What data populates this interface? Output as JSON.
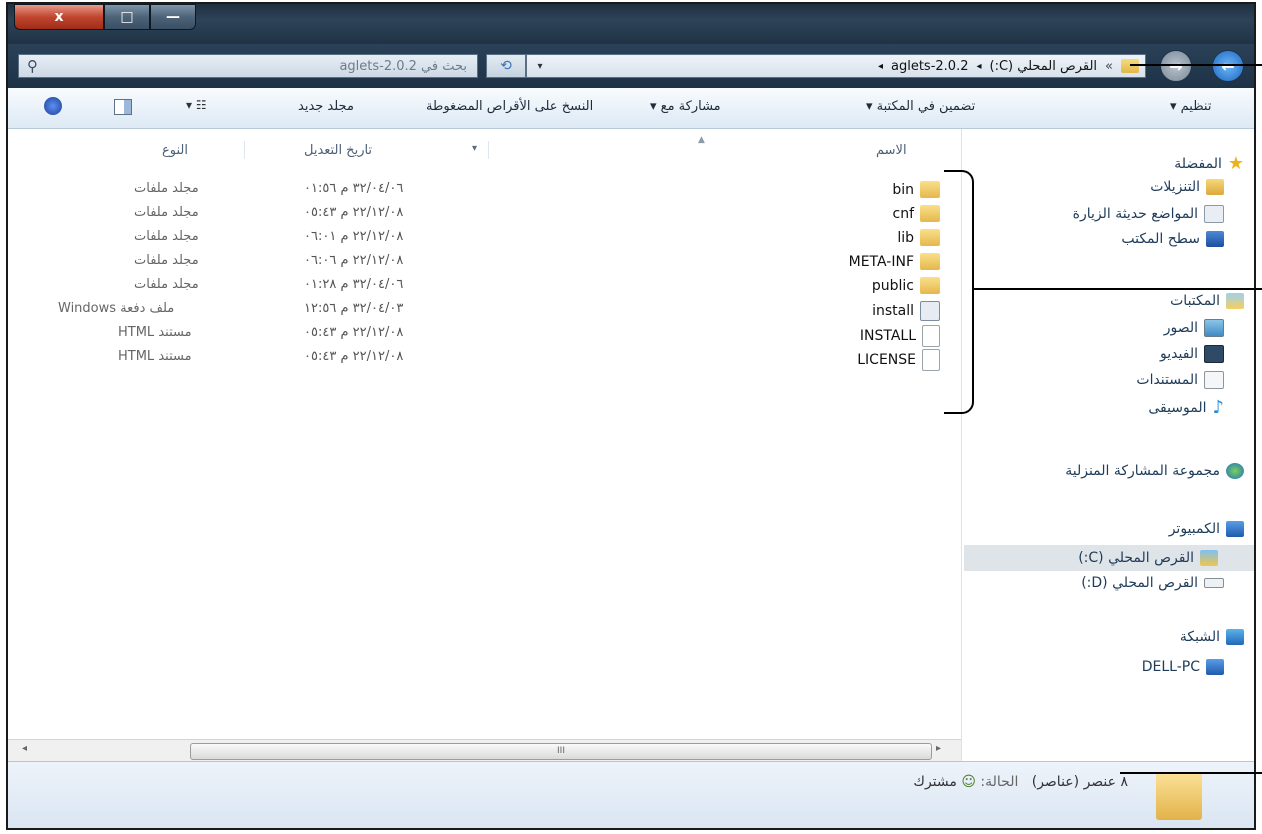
{
  "window": {
    "caption_close": "x",
    "caption_max": "□",
    "caption_min": "—"
  },
  "search": {
    "placeholder": "بحث في aglets-2.0.2",
    "icon": "search-icon"
  },
  "address": {
    "crumbs": [
      "القرص المحلي (C:)",
      "aglets-2.0.2"
    ],
    "prefix": "»",
    "sep": "◂",
    "dropdown": "▾",
    "refresh": "⟲"
  },
  "toolbar": {
    "organize": "تنظيم ▾",
    "include": "تضمين في المكتبة ▾",
    "share": "مشاركة مع ▾",
    "burn": "النسخ على الأقراص المضغوطة",
    "new_folder": "مجلد جديد"
  },
  "sidebar": {
    "favorites": "المفضلة",
    "downloads": "التنزيلات",
    "recent": "المواضع حديثة الزيارة",
    "desktop": "سطح المكتب",
    "libraries": "المكتبات",
    "pictures": "الصور",
    "videos": "الفيديو",
    "documents": "المستندات",
    "music": "الموسيقى",
    "homegroup": "مجموعة المشاركة المنزلية",
    "computer": "الكمبيوتر",
    "drive_c": "القرص المحلي (C:)",
    "drive_d": "القرص المحلي (D:)",
    "network": "الشبكة",
    "dell_pc": "DELL-PC"
  },
  "columns": {
    "name": "الاسم",
    "date": "تاريخ التعديل",
    "type": "النوع"
  },
  "files": [
    {
      "name": "bin",
      "kind": "folder",
      "date": "٣٢/٠٤/٠٦ م ٠١:٥٦",
      "type": "مجلد ملفات"
    },
    {
      "name": "cnf",
      "kind": "folder",
      "date": "٢٢/١٢/٠٨ م ٠٥:٤٣",
      "type": "مجلد ملفات"
    },
    {
      "name": "lib",
      "kind": "folder",
      "date": "٢٢/١٢/٠٨ م ٠٦:٠١",
      "type": "مجلد ملفات"
    },
    {
      "name": "META-INF",
      "kind": "folder",
      "date": "٢٢/١٢/٠٨ م ٠٦:٠٦",
      "type": "مجلد ملفات"
    },
    {
      "name": "public",
      "kind": "folder",
      "date": "٣٢/٠٤/٠٦ م ٠١:٢٨",
      "type": "مجلد ملفات"
    },
    {
      "name": "install",
      "kind": "batch",
      "date": "٣٢/٠٤/٠٣ م ١٢:٥٦",
      "type": "ملف دفعة Windows"
    },
    {
      "name": "INSTALL",
      "kind": "file",
      "date": "٢٢/١٢/٠٨ م ٠٥:٤٣",
      "type": "مستند HTML"
    },
    {
      "name": "LICENSE",
      "kind": "file",
      "date": "٢٢/١٢/٠٨ م ٠٥:٤٣",
      "type": "مستند HTML"
    }
  ],
  "status": {
    "count": "٨ عنصر (عناصر)",
    "state_label": "الحالة:",
    "state_value": "مشترك"
  },
  "scrollbar": {
    "grip": "III",
    "left": "◂",
    "right": "▸"
  }
}
